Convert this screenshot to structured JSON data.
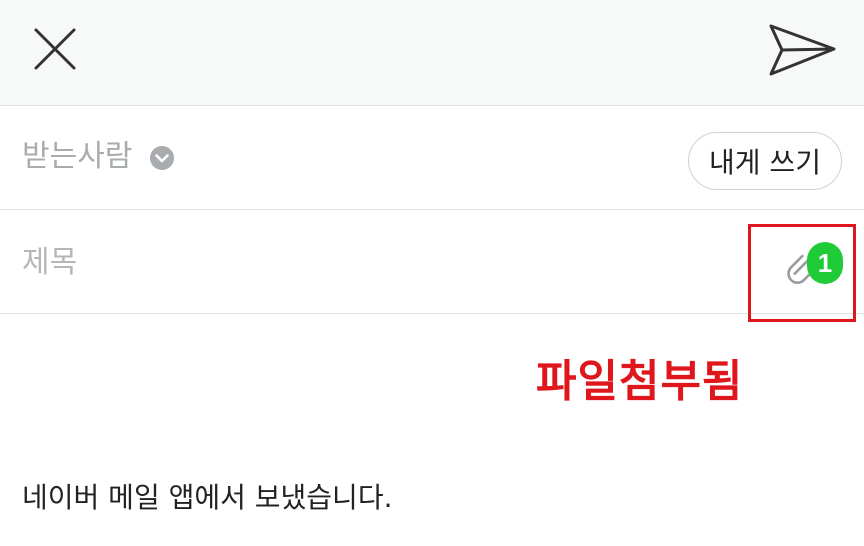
{
  "toolbar": {
    "close_icon": "close-icon",
    "send_icon": "send-icon"
  },
  "recipient": {
    "label": "받는사람",
    "toggle_icon": "chevron-down-circle-icon",
    "write_to_me_label": "내게 쓰기"
  },
  "subject": {
    "placeholder": "제목",
    "value": "",
    "attachment_icon": "paperclip-icon",
    "attachment_count": "1"
  },
  "annotation": {
    "text": "파일첨부됨"
  },
  "body": {
    "signature": "네이버 메일 앱에서 보냈습니다."
  },
  "colors": {
    "badge": "#1fcb37",
    "annotation": "#e0161d",
    "toolbar_bg": "#f7f8f8"
  }
}
